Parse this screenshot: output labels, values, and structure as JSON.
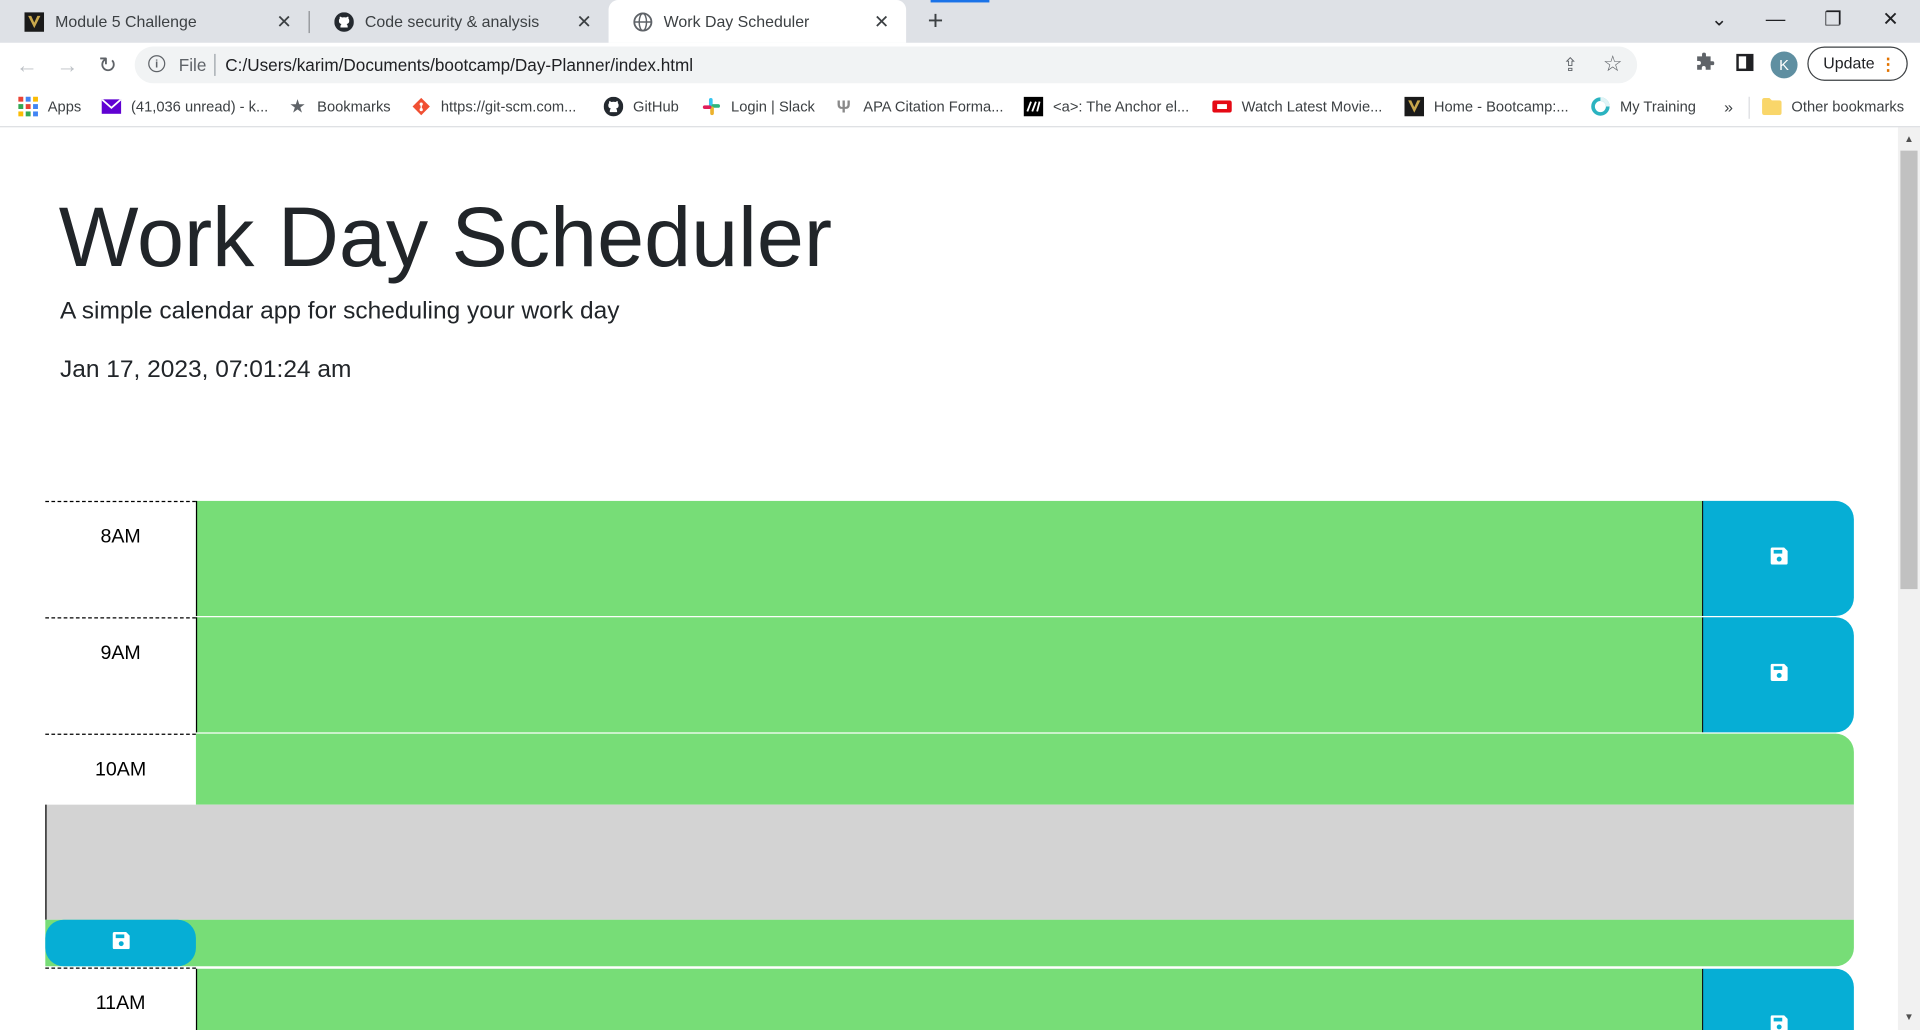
{
  "browser": {
    "tabs": [
      {
        "title": "Module 5 Challenge",
        "icon": "vanderbilt-v-icon",
        "active": false
      },
      {
        "title": "Code security & analysis",
        "icon": "github-icon",
        "active": false
      },
      {
        "title": "Work Day Scheduler",
        "icon": "globe-icon",
        "active": true
      }
    ],
    "new_tab_label": "+",
    "address": {
      "scheme_label": "File",
      "url": "C:/Users/karim/Documents/bootcamp/Day-Planner/index.html"
    },
    "profile_initial": "K",
    "update_label": "Update",
    "bookmarks": [
      {
        "label": "Apps",
        "icon": "apps-grid-icon"
      },
      {
        "label": "(41,036 unread) - k...",
        "icon": "mail-icon"
      },
      {
        "label": "Bookmarks",
        "icon": "star-icon"
      },
      {
        "label": "https://git-scm.com...",
        "icon": "git-icon"
      },
      {
        "label": "GitHub",
        "icon": "github-icon"
      },
      {
        "label": "Login | Slack",
        "icon": "slack-icon"
      },
      {
        "label": "APA Citation Forma...",
        "icon": "purdue-icon"
      },
      {
        "label": "<a>: The Anchor el...",
        "icon": "mdn-icon"
      },
      {
        "label": "Watch Latest Movie...",
        "icon": "movie-icon"
      },
      {
        "label": "Home - Bootcamp:...",
        "icon": "vanderbilt-v-icon"
      },
      {
        "label": "My Training",
        "icon": "training-icon"
      }
    ],
    "overflow_label": "»",
    "other_bookmarks_label": "Other bookmarks",
    "colors": {
      "tab_strip": "#dee1e6",
      "accent": "#1a73e8"
    }
  },
  "page": {
    "title": "Work Day Scheduler",
    "lead": "A simple calendar app for scheduling your work day",
    "current_day": "Jan 17, 2023, 07:01:24 am",
    "hours": [
      {
        "label": "8AM",
        "state": "future",
        "text": ""
      },
      {
        "label": "9AM",
        "state": "future",
        "text": ""
      },
      {
        "label": "10AM",
        "state": "future",
        "text": ""
      },
      {
        "label": "11AM",
        "state": "future",
        "text": ""
      }
    ],
    "colors": {
      "future": "#77dd77",
      "past": "#d3d3d3",
      "save": "#06aed5"
    },
    "save_icon": "floppy-disk-icon"
  }
}
